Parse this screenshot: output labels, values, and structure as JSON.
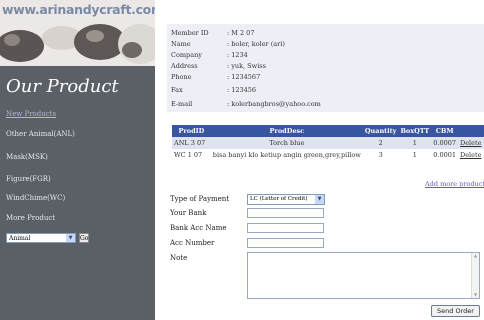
{
  "site": {
    "url": "www.arinandycraft.com"
  },
  "sidebar": {
    "title": "Our Product",
    "items": [
      {
        "label": "New Products"
      },
      {
        "label": "Other Animal(ANL)"
      },
      {
        "label": "Mask(MSK)"
      },
      {
        "label": "Figure(FGR)"
      },
      {
        "label": "WindChime(WC)"
      },
      {
        "label": "More Product"
      }
    ],
    "category_select": {
      "value": "Animal"
    },
    "go_label": "Go"
  },
  "member": {
    "rows": [
      {
        "label": "Member ID",
        "value": ": M 2 07"
      },
      {
        "label": "Name",
        "value": ": boler, koler (ari)"
      },
      {
        "label": "Company",
        "value": ": 1234"
      },
      {
        "label": "Address",
        "value": ": yuk, Swiss"
      },
      {
        "label": "Phone",
        "value": ": 1234567"
      },
      {
        "label": "Fax",
        "value": ": 123456"
      },
      {
        "label": "E-mail",
        "value": ": kolerbangbros@yahoo.com"
      }
    ]
  },
  "order_table": {
    "headers": [
      "ProdID",
      "ProdDesc",
      "Quantity",
      "BoxQTT",
      "CBM",
      ""
    ],
    "rows": [
      {
        "prod_id": "ANL 3 07",
        "desc": "Torch blue",
        "qty": "2",
        "box": "1",
        "cbm": "0.0007",
        "action": "Delete"
      },
      {
        "prod_id": "WC 1 07",
        "desc": "bisa banyi klo ketiup angin green,grey,pillow",
        "qty": "3",
        "box": "1",
        "cbm": "0.0001",
        "action": "Delete"
      }
    ]
  },
  "add_more_label": "Add more product",
  "form": {
    "payment_label": "Type of Payment",
    "payment_value": "LC (Letter of Credit)",
    "bank_label": "Your Bank",
    "acc_name_label": "Bank Acc Name",
    "acc_number_label": "Acc Number",
    "note_label": "Note"
  },
  "send_label": "Send Order"
}
